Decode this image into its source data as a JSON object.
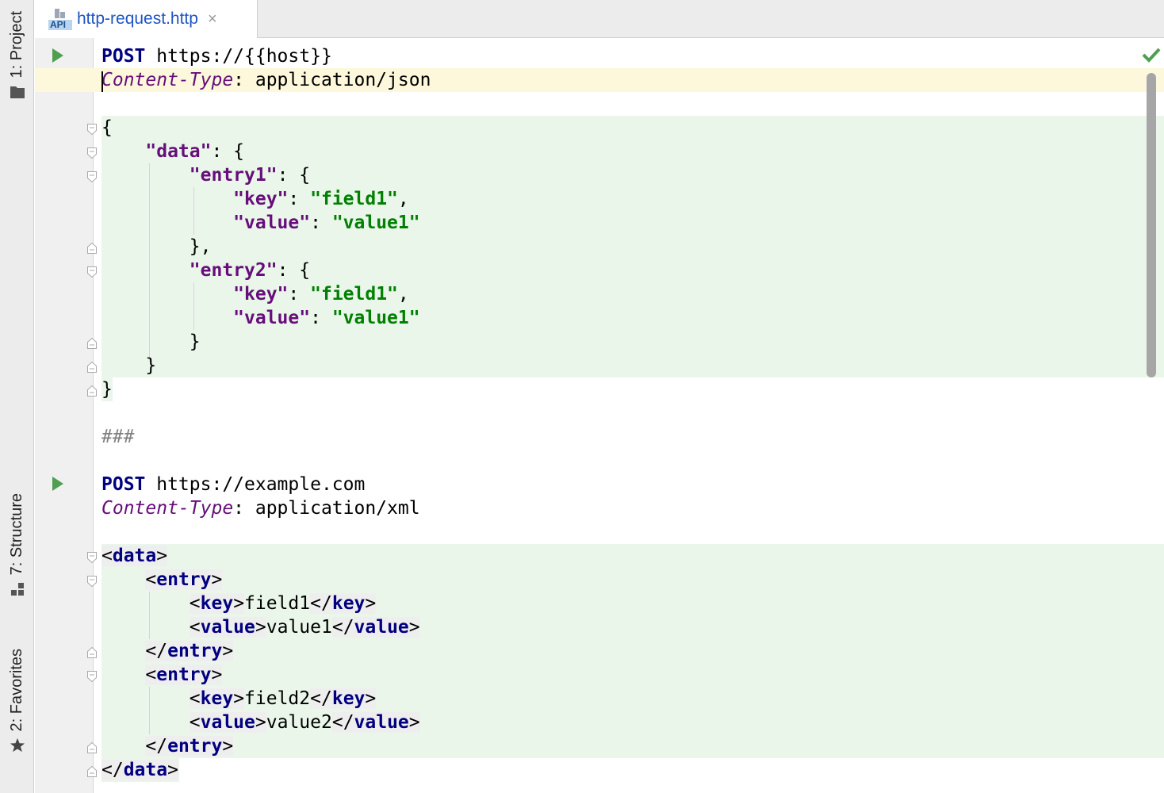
{
  "sidebar": {
    "tabs": [
      {
        "label": "1: Project",
        "icon": "folder-icon"
      },
      {
        "label": "7: Structure",
        "icon": "structure-icon"
      },
      {
        "label": "2: Favorites",
        "icon": "star-icon"
      }
    ]
  },
  "editor_tab": {
    "icon_text": "API",
    "filename": "http-request.http",
    "close_glyph": "×"
  },
  "code": {
    "req1": {
      "method": "POST",
      "url": " https://{{host}}",
      "header_name": "Content-Type",
      "header_value": ": application/json"
    },
    "json": {
      "open_brace": "{",
      "data_key": "\"data\"",
      "entry1_key": "\"entry1\"",
      "key_key": "\"key\"",
      "value_key": "\"value\"",
      "field1": "\"field1\"",
      "value1": "\"value1\"",
      "entry2_key": "\"entry2\"",
      "close_brace": "}",
      "colon_brace": ": {",
      "colon": ": ",
      "comma": ",",
      "close_brace_comma": "},"
    },
    "separator": "###",
    "req2": {
      "method": "POST",
      "url": " https://example.com",
      "header_name": "Content-Type",
      "header_value": ": application/xml"
    },
    "xml": {
      "data_tag": "data",
      "entry_tag": "entry",
      "key_tag": "key",
      "value_tag": "value",
      "field1": "field1",
      "value1": "value1",
      "field2": "field2",
      "value2": "value2"
    }
  },
  "colors": {
    "keyword": "#000080",
    "header": "#660e7a",
    "string": "#008000",
    "injected_bg": "#eaf6ea",
    "caret_line_bg": "#fdf8dc",
    "run_icon": "#4f9f52"
  }
}
